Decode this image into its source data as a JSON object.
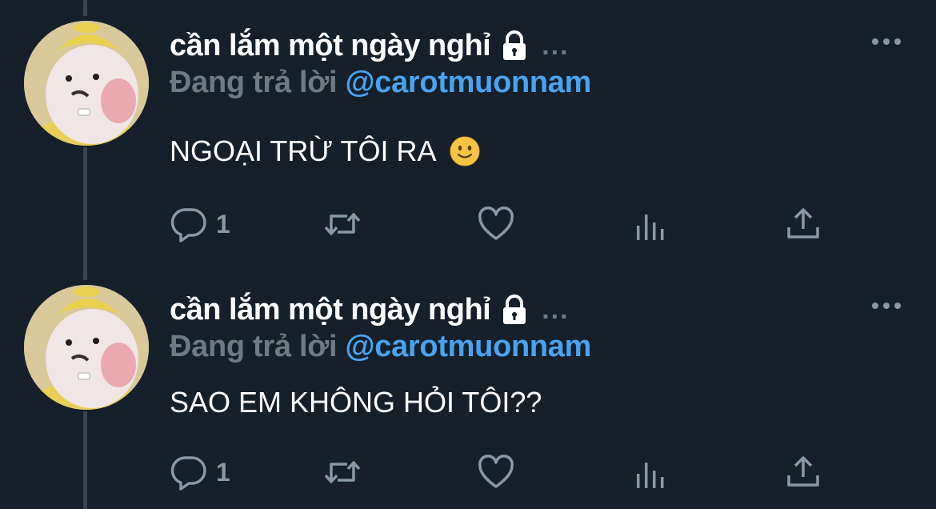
{
  "tweets": [
    {
      "display_name": "cần lắm một ngày nghỉ",
      "name_overflow": "...",
      "reply_prefix": "Đang trả lời",
      "reply_handle": "@carotmuonnam",
      "text": "NGOẠI TRỪ TÔI RA",
      "emoji": "slightly-smiling-face",
      "reply_count": "1",
      "icons": [
        "lock-icon",
        "more-icon",
        "reply-icon",
        "retweet-icon",
        "like-icon",
        "analytics-icon",
        "share-icon"
      ]
    },
    {
      "display_name": "cần lắm một ngày nghỉ",
      "name_overflow": "...",
      "reply_prefix": "Đang trả lời",
      "reply_handle": "@carotmuonnam",
      "text": "SAO EM KHÔNG HỎI TÔI??",
      "reply_count": "1",
      "icons": [
        "lock-icon",
        "more-icon",
        "reply-icon",
        "retweet-icon",
        "like-icon",
        "analytics-icon",
        "share-icon"
      ]
    }
  ],
  "colors": {
    "background": "#15202b",
    "text_primary": "#ffffff",
    "text_secondary": "#6e7b87",
    "link": "#4aa3f0",
    "icon": "#8899a6"
  }
}
